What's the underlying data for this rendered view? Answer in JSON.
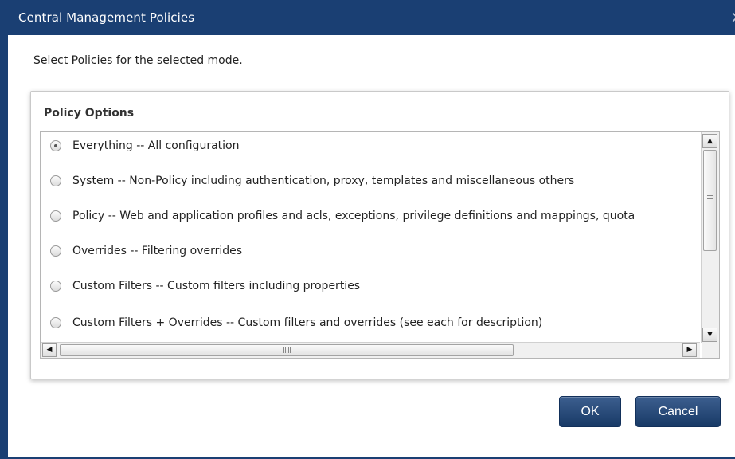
{
  "dialog": {
    "title": "Central Management Policies",
    "close_glyph": "×",
    "instruction": "Select Policies for the selected mode."
  },
  "panel": {
    "title": "Policy Options",
    "options": [
      {
        "label": "Everything -- All configuration",
        "checked": true
      },
      {
        "label": "System -- Non-Policy including authentication, proxy, templates and miscellaneous others",
        "checked": false
      },
      {
        "label": "Policy -- Web and application profiles and acls, exceptions, privilege definitions and mappings, quota",
        "checked": false
      },
      {
        "label": "Overrides -- Filtering overrides",
        "checked": false
      },
      {
        "label": "Custom Filters -- Custom filters including properties",
        "checked": false
      },
      {
        "label": "Custom Filters + Overrides -- Custom filters and overrides (see each for description)",
        "checked": false
      }
    ],
    "scroll_up_glyph": "▲",
    "scroll_down_glyph": "▼",
    "scroll_left_glyph": "◀",
    "scroll_right_glyph": "▶"
  },
  "buttons": {
    "ok": "OK",
    "cancel": "Cancel"
  },
  "colors": {
    "titlebar": "#1a3f73",
    "button": "#1f426f"
  }
}
